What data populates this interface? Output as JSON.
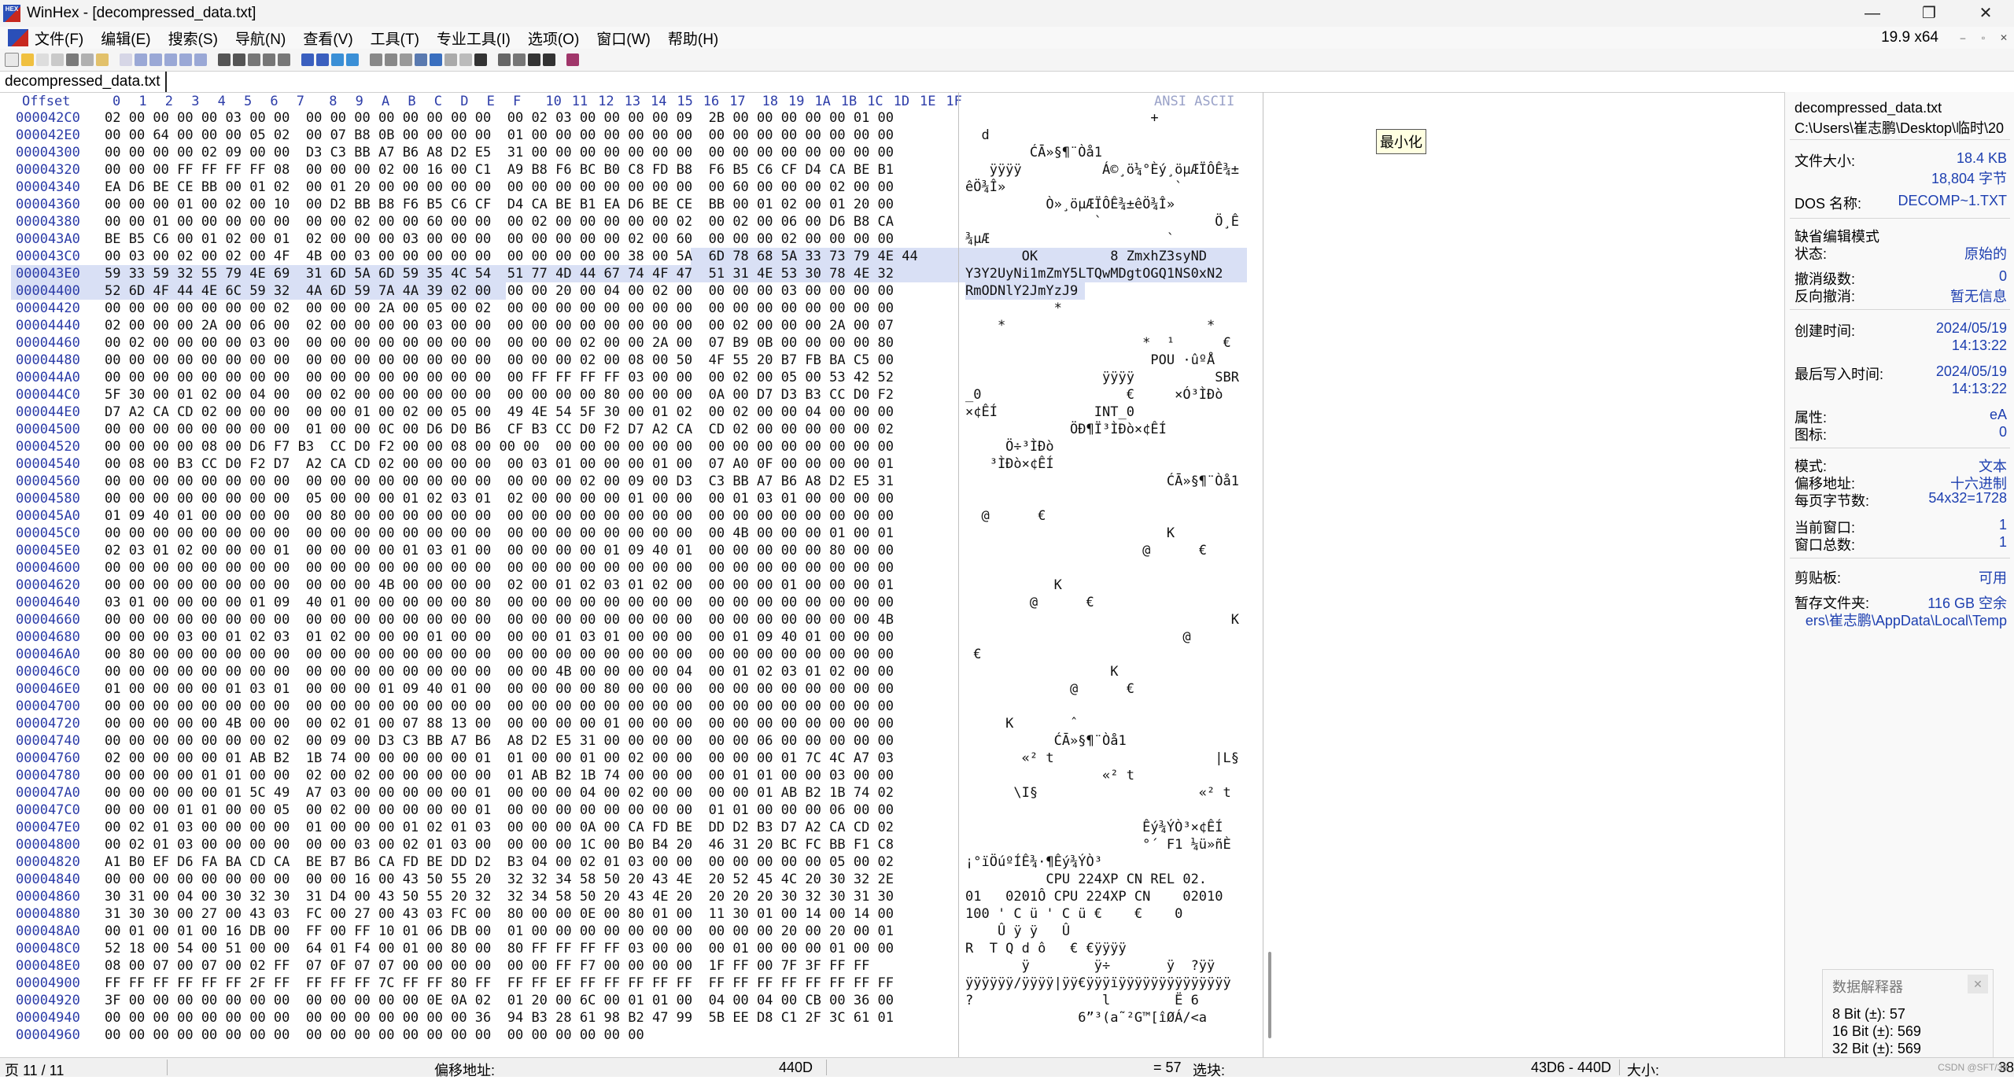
{
  "window": {
    "title": "WinHex - [decompressed_data.txt]",
    "app_logo": "HEX",
    "controls": [
      "—",
      "❐",
      "✕"
    ]
  },
  "menubar": {
    "items": [
      "文件(F)",
      "编辑(E)",
      "搜索(S)",
      "导航(N)",
      "查看(V)",
      "工具(T)",
      "专业工具(I)",
      "选项(O)",
      "窗口(W)",
      "帮助(H)"
    ],
    "version": "19.9 x64",
    "mini_controls": [
      "–",
      "▫",
      "✕"
    ]
  },
  "tab": {
    "label": "decompressed_data.txt"
  },
  "hex_header": {
    "offset_label": "Offset",
    "columns": [
      "0",
      "1",
      "2",
      "3",
      "4",
      "5",
      "6",
      "7",
      "8",
      "9",
      "A",
      "B",
      "C",
      "D",
      "E",
      "F",
      "10",
      "11",
      "12",
      "13",
      "14",
      "15",
      "16",
      "17",
      "18",
      "19",
      "1A",
      "1B",
      "1C",
      "1D",
      "1E",
      "1F"
    ],
    "ansi_label": "ANSI ASCII"
  },
  "hex_rows": [
    {
      "offset": "000042C0",
      "hex": "02 00 00 00 00 03 00 00  00 00 00 00 00 00 00 00  00 02 03 00 00 00 00 09  2B 00 00 00 00 00 01 00",
      "ascii": "                       +          "
    },
    {
      "offset": "000042E0",
      "hex": "00 00 64 00 00 00 05 02  00 07 B8 0B 00 00 00 00  01 00 00 00 00 00 00 00  00 00 00 00 00 00 00 00",
      "ascii": "  d                              "
    },
    {
      "offset": "00004300",
      "hex": "00 00 00 00 02 09 00 00  D3 C3 BB A7 B6 A8 D2 E5  31 00 00 00 00 00 00 00  00 00 00 00 00 00 00 00",
      "ascii": "        ĆĀ»§¶¨Òå1                "
    },
    {
      "offset": "00004320",
      "hex": "00 00 00 FF FF FF FF 08  00 00 00 02 00 16 00 C1  A9 B8 F6 BC B0 C8 FD B8  F6 B5 C6 CF D4 CA BE B1",
      "ascii": "   ÿÿÿÿ          Á©¸ö¼°Èý¸öµÆÏÔÊ¾±"
    },
    {
      "offset": "00004340",
      "hex": "EA D6 BE CE BB 00 01 02  00 01 20 00 00 00 00 00  00 00 00 00 00 00 00 00  00 60 00 00 00 02 00 00",
      "ascii": "êÖ¾Î»                     `      "
    },
    {
      "offset": "00004360",
      "hex": "00 00 00 01 00 02 00 10  00 D2 BB B8 F6 B5 C6 CF  D4 CA BE B1 EA D6 BE CE  BB 00 01 02 00 01 20 00",
      "ascii": "          Ò»¸öµÆÏÔÊ¾±êÖ¾Î»       "
    },
    {
      "offset": "00004380",
      "hex": "00 00 01 00 00 00 00 00  00 00 02 00 00 60 00 00  00 02 00 00 00 00 00 02  00 02 00 06 00 D6 B8 CA",
      "ascii": "                `              Ö¸Ê"
    },
    {
      "offset": "000043A0",
      "hex": "BE B5 C6 00 01 02 00 01  02 00 00 00 03 00 00 00  00 00 00 00 00 02 00 60  00 00 00 02 00 00 00 00",
      "ascii": "¾µÆ                      `       "
    },
    {
      "offset": "000043C0",
      "hex": "00 03 00 02 00 02 00 4F  4B 00 03 00 00 00 00 00  00 00 00 00 00 38 00 5A  6D 78 68 5A 33 73 79 4E 44",
      "ascii": "       OK         8 ZmxhZ3syND"
    },
    {
      "offset": "000043E0",
      "hex": "59 33 59 32 55 79 4E 69  31 6D 5A 6D 59 35 4C 54  51 77 4D 44 67 74 4F 47  51 31 4E 53 30 78 4E 32",
      "ascii": "Y3Y2UyNi1mZmY5LTQwMDgtOGQ1NS0xN2"
    },
    {
      "offset": "00004400",
      "hex": "52 6D 4F 44 4E 6C 59 32  4A 6D 59 7A 4A 39 02 00  00 00 20 00 04 00 02 00  00 00 00 03 00 00 00 00",
      "ascii": "RmODNlY2JmYzJ9                    "
    },
    {
      "offset": "00004420",
      "hex": "00 00 00 00 00 00 00 02  00 00 00 2A 00 05 00 02  00 00 00 00 00 00 00 00  00 00 00 00 00 00 00 00",
      "ascii": "           *                      "
    },
    {
      "offset": "00004440",
      "hex": "02 00 00 00 2A 00 06 00  02 00 00 00 00 03 00 00  00 00 00 00 00 00 00 00  00 02 00 00 00 2A 00 07",
      "ascii": "    *                         *   "
    },
    {
      "offset": "00004460",
      "hex": "00 02 00 00 00 00 03 00  00 00 00 00 00 00 00 00  00 00 00 02 00 00 2A 00  07 B9 0B 00 00 00 00 80",
      "ascii": "                      *  ¹      €"
    },
    {
      "offset": "00004480",
      "hex": "00 00 00 00 00 00 00 00  00 00 00 00 00 00 00 00  00 00 00 02 00 08 00 50  4F 55 20 B7 FB BA C5 00",
      "ascii": "                       POU ·ûºÅ  "
    },
    {
      "offset": "000044A0",
      "hex": "00 00 00 00 00 00 00 00  00 00 00 00 00 00 00 00  00 FF FF FF FF 03 00 00  00 02 00 05 00 53 42 52",
      "ascii": "                 ÿÿÿÿ          SBR"
    },
    {
      "offset": "000044C0",
      "hex": "5F 30 00 01 02 00 04 00  00 02 00 00 00 00 00 00  00 00 00 00 80 00 00 00  0A 00 D7 D3 B3 CC D0 F2",
      "ascii": "_0                  €     ×Ó³ÌÐò"
    },
    {
      "offset": "000044E0",
      "hex": "D7 A2 CA CD 02 00 00 00  00 00 01 00 02 00 05 00  49 4E 54 5F 30 00 01 02  00 02 00 00 04 00 00 00",
      "ascii": "×¢ÊÍ            INT_0            "
    },
    {
      "offset": "00004500",
      "hex": "00 00 00 00 00 00 00 00  01 00 00 0C 00 D6 D0 B6  CF B3 CC D0 F2 D7 A2 CA  CD 02 00 00 00 00 00 02",
      "ascii": "             ÖÐ¶Ï³ÌÐò×¢ÊÍ        "
    },
    {
      "offset": "00004520",
      "hex": "00 00 00 00 08 00 D6 F7 B3  CC D0 F2 00 00 08 00 00 00  00 00 00 00 00 00  00 00 00 00 00 00 00 00",
      "ascii": "     Ö÷³ÌÐò                       "
    },
    {
      "offset": "00004540",
      "hex": "00 08 00 B3 CC D0 F2 D7  A2 CA CD 02 00 00 00 00  00 03 01 00 00 00 01 00  07 A0 0F 00 00 00 00 01",
      "ascii": "   ³ÌÐò×¢ÊÍ                       "
    },
    {
      "offset": "00004560",
      "hex": "00 00 00 00 00 00 00 00  00 00 00 00 00 00 00 00  00 00 00 02 00 09 00 D3  C3 BB A7 B6 A8 D2 E5 31",
      "ascii": "                         ĆĀ»§¶¨Òå1"
    },
    {
      "offset": "00004580",
      "hex": "00 00 00 00 00 00 00 00  05 00 00 00 01 02 03 01  02 00 00 00 00 01 00 00  00 01 03 01 00 00 00 00",
      "ascii": "                                  "
    },
    {
      "offset": "000045A0",
      "hex": "01 09 40 01 00 00 00 00  00 80 00 00 00 00 00 00  00 00 00 00 00 00 00 00  00 00 00 00 00 00 00 00",
      "ascii": "  @      €                        "
    },
    {
      "offset": "000045C0",
      "hex": "00 00 00 00 00 00 00 00  00 00 00 00 00 00 00 00  00 00 00 00 00 00 00 00  00 4B 00 00 00 01 00 01",
      "ascii": "                         K        "
    },
    {
      "offset": "000045E0",
      "hex": "02 03 01 02 00 00 00 01  00 00 00 00 01 03 01 00  00 00 00 00 01 09 40 01  00 00 00 00 00 80 00 00",
      "ascii": "                      @      €    "
    },
    {
      "offset": "00004600",
      "hex": "00 00 00 00 00 00 00 00  00 00 00 00 00 00 00 00  00 00 00 00 00 00 00 00  00 00 00 00 00 00 00 00",
      "ascii": "                                  "
    },
    {
      "offset": "00004620",
      "hex": "00 00 00 00 00 00 00 00  00 00 00 4B 00 00 00 00  02 00 01 02 03 01 02 00  00 00 00 01 00 00 00 01",
      "ascii": "           K                      "
    },
    {
      "offset": "00004640",
      "hex": "03 01 00 00 00 00 01 09  40 01 00 00 00 00 00 80  00 00 00 00 00 00 00 00  00 00 00 00 00 00 00 00",
      "ascii": "        @      €                  "
    },
    {
      "offset": "00004660",
      "hex": "00 00 00 00 00 00 00 00  00 00 00 00 00 00 00 00  00 00 00 00 00 00 00 00  00 00 00 00 00 00 00 4B",
      "ascii": "                                 K"
    },
    {
      "offset": "00004680",
      "hex": "00 00 00 03 00 01 02 03  01 02 00 00 00 01 00 00  00 00 01 03 01 00 00 00  00 01 09 40 01 00 00 00",
      "ascii": "                           @      "
    },
    {
      "offset": "000046A0",
      "hex": "00 80 00 00 00 00 00 00  00 00 00 00 00 00 00 00  00 00 00 00 00 00 00 00  00 00 00 00 00 00 00 00",
      "ascii": " €                                "
    },
    {
      "offset": "000046C0",
      "hex": "00 00 00 00 00 00 00 00  00 00 00 00 00 00 00 00  00 00 4B 00 00 00 00 04  00 01 02 03 01 02 00 00",
      "ascii": "                  K               "
    },
    {
      "offset": "000046E0",
      "hex": "01 00 00 00 00 01 03 01  00 00 00 01 09 40 01 00  00 00 00 00 80 00 00 00  00 00 00 00 00 00 00 00",
      "ascii": "             @      €             "
    },
    {
      "offset": "00004700",
      "hex": "00 00 00 00 00 00 00 00  00 00 00 00 00 00 00 00  00 00 00 00 00 00 00 00  00 00 00 00 00 00 00 00",
      "ascii": "                                  "
    },
    {
      "offset": "00004720",
      "hex": "00 00 00 00 00 4B 00 00  00 02 01 00 07 88 13 00  00 00 00 00 01 00 00 00  00 00 00 00 00 00 00 00",
      "ascii": "     K       ˆ                    "
    },
    {
      "offset": "00004740",
      "hex": "00 00 00 00 00 00 00 02  00 09 00 D3 C3 BB A7 B6  A8 D2 E5 31 00 00 00 00  00 00 06 00 00 00 00 00",
      "ascii": "           ĆĀ»§¶¨Òå1              "
    },
    {
      "offset": "00004760",
      "hex": "02 00 00 00 00 01 AB B2  1B 74 00 00 00 00 00 01  01 00 00 01 00 02 00 00  00 00 00 01 7C 4C A7 03",
      "ascii": "       «² t                    |L§ "
    },
    {
      "offset": "00004780",
      "hex": "00 00 00 00 01 01 00 00  02 00 02 00 00 00 00 00  01 AB B2 1B 74 00 00 00  00 01 01 00 00 03 00 00",
      "ascii": "                 «² t             "
    },
    {
      "offset": "000047A0",
      "hex": "00 00 00 00 00 01 5C 49  A7 03 00 00 00 00 00 01  00 00 00 04 00 02 00 00  00 00 01 AB B2 1B 74 02",
      "ascii": "      \\I§                    «² t "
    },
    {
      "offset": "000047C0",
      "hex": "00 00 00 01 01 00 00 05  00 02 00 00 00 00 00 01  00 00 00 00 00 00 00 00  01 01 00 00 00 06 00 00",
      "ascii": "                                  "
    },
    {
      "offset": "000047E0",
      "hex": "00 02 01 03 00 00 00 00  01 00 00 00 01 02 01 03  00 00 00 0A 00 CA FD BE  DD D2 B3 D7 A2 CA CD 02",
      "ascii": "                      Êý¾ÝÒ³×¢ÊÍ "
    },
    {
      "offset": "00004800",
      "hex": "00 02 01 03 00 00 00 00  00 00 03 00 02 01 03 00  00 00 00 1C 00 B0 B4 20  46 31 20 BC FC BB F1 C8",
      "ascii": "                      °´ F1 ¼ü»ñÈ"
    },
    {
      "offset": "00004820",
      "hex": "A1 B0 EF D6 FA BA CD CA  BE B7 B6 CA FD BE DD D2  B3 04 00 02 01 03 00 00  00 00 00 00 00 05 00 02",
      "ascii": "¡°ïÖúºÍÊ¾·¶Êý¾ÝÒ³               "
    },
    {
      "offset": "00004840",
      "hex": "00 00 00 00 00 00 00 00  00 00 16 00 43 50 55 20  32 32 34 58 50 20 43 4E  20 52 45 4C 20 30 32 2E",
      "ascii": "          CPU 224XP CN REL 02."
    },
    {
      "offset": "00004860",
      "hex": "30 31 00 04 00 30 32 30  31 D4 00 43 50 55 20 32  32 34 58 50 20 43 4E 20  20 20 20 30 32 30 31 30",
      "ascii": "01   0201Ô CPU 224XP CN    02010"
    },
    {
      "offset": "00004880",
      "hex": "31 30 30 00 27 00 43 03  FC 00 27 00 43 03 FC 00  80 00 00 0E 00 80 01 00  11 30 01 00 14 00 14 00",
      "ascii": "100 ' C ü ' C ü €    €    0      "
    },
    {
      "offset": "000048A0",
      "hex": "00 01 00 01 00 16 DB 00  FF 00 FF 10 01 06 DB 00  01 00 00 00 00 00 00 00  00 00 00 20 00 20 00 01",
      "ascii": "    Û ÿ ÿ   Û                     "
    },
    {
      "offset": "000048C0",
      "hex": "52 18 00 54 00 51 00 00  64 01 F4 00 01 00 80 00  80 FF FF FF FF 03 00 00  00 01 00 00 00 01 00 00",
      "ascii": "R  T Q d ô   € €ÿÿÿÿ              "
    },
    {
      "offset": "000048E0",
      "hex": "08 00 07 00 07 00 02 FF  07 0F 07 07 00 00 00 00  00 00 FF F7 00 00 00 00  1F FF 00 7F 3F FF FF",
      "ascii": "       ÿ        ÿ÷       ÿ  ?ÿÿ"
    },
    {
      "offset": "00004900",
      "hex": "FF FF FF FF FF FF 2F FF  FF FF FF 7C FF FF 80 FF  FF FF EF FF FF FF FF FF  FF FF FF FF FF FF FF FF",
      "ascii": "ÿÿÿÿÿÿ/ÿÿÿÿ|ÿÿ€ÿÿÿïÿÿÿÿÿÿÿÿÿÿÿÿÿÿ"
    },
    {
      "offset": "00004920",
      "hex": "3F 00 00 00 00 00 00 00  00 00 00 00 00 0E 0A 02  01 20 00 6C 00 01 01 00  04 00 04 00 CB 00 36 00",
      "ascii": "?                l        Ë 6    "
    },
    {
      "offset": "00004940",
      "hex": "00 00 00 00 00 00 00 00  00 00 00 00 00 00 00 36  94 B3 28 61 98 B2 47 99  5B EE D8 C1 2F 3C 61 01",
      "ascii": "              6”³(a˜²G™[îØÁ/<a "
    },
    {
      "offset": "00004960",
      "hex": "00 00 00 00 00 00 00 00  00 00 00 00 00 00 00 00  00 00 00 00 00 00",
      "ascii": ""
    }
  ],
  "tooltip": {
    "label": "最小化"
  },
  "info_panel": {
    "filename": "decompressed_data.txt",
    "path": "C:\\Users\\崔志鹏\\Desktop\\临时\\20",
    "file_size_label": "文件大小:",
    "file_size_kb": "18.4 KB",
    "file_size_bytes": "18,804 字节",
    "dos_name_label": "DOS 名称:",
    "dos_name": "DECOMP~1.TXT",
    "edit_mode_label": "缺省编辑模式",
    "state_label": "状态:",
    "state": "原始的",
    "undo_level_label": "撤消级数:",
    "undo_level": "0",
    "undo_reverse_label": "反向撤消:",
    "undo_reverse": "暂无信息",
    "created_label": "创建时间:",
    "created_date": "2024/05/19",
    "created_time": "14:13:22",
    "modified_label": "最后写入时间:",
    "modified_date": "2024/05/19",
    "modified_time": "14:13:22",
    "attr_label": "属性:",
    "attr": "eA",
    "icon_label": "图标:",
    "icon": "0",
    "mode_label": "模式:",
    "mode": "文本",
    "offset_addr_label": "偏移地址:",
    "offset_addr": "十六进制",
    "bytes_per_page_label": "每页字节数:",
    "bytes_per_page": "54x32=1728",
    "current_window_label": "当前窗口:",
    "current_window": "1",
    "total_windows_label": "窗口总数:",
    "total_windows": "1",
    "clipboard_label": "剪贴板:",
    "clipboard": "可用",
    "temp_label": "暂存文件夹:",
    "temp_free": "116 GB 空余",
    "temp_path": "ers\\崔志鹏\\AppData\\Local\\Temp"
  },
  "data_interpreter": {
    "title": "数据解释器",
    "close": "✕",
    "bit8": "8 Bit (±): 57",
    "bit16": "16 Bit (±): 569",
    "bit32": "32 Bit (±): 569"
  },
  "statusbar": {
    "page": "页 11 / 11",
    "offset_label": "偏移地址:",
    "offset_value": "440D",
    "value": "= 57",
    "selection_label": "选块:",
    "selection_range": "43D6 - 440D",
    "size_label": "大小:",
    "size_value": "38"
  },
  "watermark": "CSDN @SFT/38"
}
